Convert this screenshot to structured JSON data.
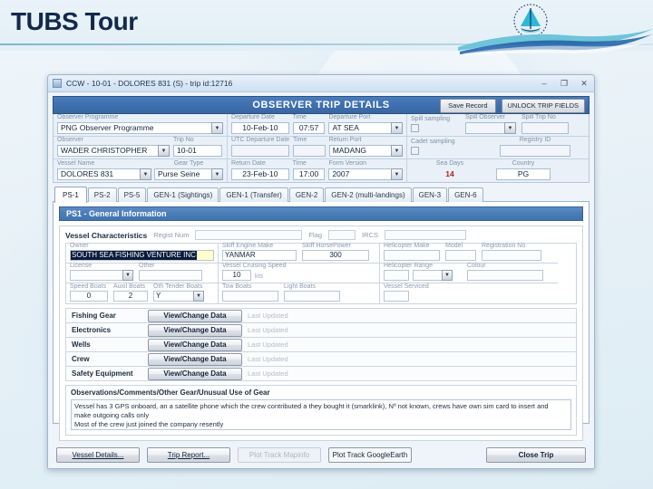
{
  "slide": {
    "title": "TUBS Tour",
    "logo_name": "sailboat-logo"
  },
  "window": {
    "titlebar_text": "CCW - 10-01 - DOLORES 831 (S) - trip id:12716",
    "minimize": "–",
    "maximize": "❐",
    "close": "✕"
  },
  "trip_header": {
    "title": "OBSERVER TRIP DETAILS",
    "save_label": "Save Record",
    "unlock_label": "UNLOCK TRIP FIELDS"
  },
  "trip_fields": {
    "observer_programme": {
      "label": "Observer Programme",
      "value": "PNG Observer Programme"
    },
    "observer": {
      "label": "Observer",
      "value": "WADER CHRISTOPHER"
    },
    "trip_no": {
      "label": "Trip No",
      "value": "10-01"
    },
    "vessel_name": {
      "label": "Vessel Name",
      "value": "DOLORES 831"
    },
    "gear_type": {
      "label": "Gear Type",
      "value": "Purse Seine"
    },
    "departure_date": {
      "label": "Departure Date",
      "value": "10-Feb-10"
    },
    "departure_time": {
      "label": "Time",
      "value": "07:57"
    },
    "departure_port": {
      "label": "Departure Port",
      "value": "AT SEA"
    },
    "utc_departure_date": {
      "label": "UTC Departure Date",
      "value": ""
    },
    "utc_departure_time": {
      "label": "Time",
      "value": ""
    },
    "return_port": {
      "label": "Return Port",
      "value": "MADANG"
    },
    "return_date": {
      "label": "Return Date",
      "value": "23-Feb-10"
    },
    "return_time": {
      "label": "Time",
      "value": "17:00"
    },
    "form_version": {
      "label": "Form Version",
      "value": "2007"
    },
    "spill_sampling": {
      "label": "Spill sampling",
      "checked": false
    },
    "spill_observer": {
      "label": "Spill Observer",
      "value": ""
    },
    "spill_trip_no": {
      "label": "Spill Trip No",
      "value": ""
    },
    "cadet_sampling": {
      "label": "Cadet sampling",
      "checked": false
    },
    "registry_id": {
      "label": "Registry ID",
      "value": ""
    },
    "sea_days": {
      "label": "Sea Days",
      "value": "14"
    },
    "country": {
      "label": "Country",
      "value": "PG"
    }
  },
  "tabs": [
    {
      "label": "PS-1",
      "active": true
    },
    {
      "label": "PS-2",
      "active": false
    },
    {
      "label": "PS-5",
      "active": false
    },
    {
      "label": "GEN-1 (Sightings)",
      "active": false
    },
    {
      "label": "GEN-1 (Transfer)",
      "active": false
    },
    {
      "label": "GEN-2",
      "active": false
    },
    {
      "label": "GEN-2 (multi-landings)",
      "active": false
    },
    {
      "label": "GEN-3",
      "active": false
    },
    {
      "label": "GEN-6",
      "active": false
    }
  ],
  "section": {
    "title": "PS1 - General Information"
  },
  "vessel_characteristics": {
    "title": "Vessel Characteristics",
    "regist_num": {
      "label": "Regist Num",
      "value": ""
    },
    "flag": {
      "label": "Flag",
      "value": ""
    },
    "ircs": {
      "label": "IRCS",
      "value": ""
    },
    "owner": {
      "label": "Owner",
      "value": "SOUTH SEA FISHING VENTURE INC"
    },
    "license": {
      "label": "License",
      "value": ""
    },
    "other": {
      "label": "Other",
      "value": ""
    },
    "speed_boats": {
      "label": "Speed Boats",
      "value": "0"
    },
    "auxil_boats": {
      "label": "Auxil Boats",
      "value": "2"
    },
    "oth_tender_boats": {
      "label": "Oth Tender Boats",
      "value": "Y"
    },
    "skiff_engine_make": {
      "label": "Skiff Engine Make",
      "value": "YANMAR"
    },
    "skiff_horsepower": {
      "label": "Skiff HorsePower",
      "value": "300"
    },
    "vessel_cruising_speed": {
      "label": "Vessel Cruising Speed",
      "value": "10",
      "unit": "kts"
    },
    "tow_boats": {
      "label": "Tow Boats",
      "value": ""
    },
    "light_boats": {
      "label": "Light Boats",
      "value": ""
    },
    "helicopter_make": {
      "label": "Helicopter Make",
      "value": ""
    },
    "model": {
      "label": "Model",
      "value": ""
    },
    "registration_no": {
      "label": "Registration No",
      "value": ""
    },
    "helicopter_range": {
      "label": "Helicopter Range",
      "value": ""
    },
    "colour": {
      "label": "Colour",
      "value": ""
    },
    "vessel_serviced": {
      "label": "Vessel Serviced",
      "value": ""
    }
  },
  "data_rows": [
    {
      "name": "Fishing Gear",
      "button": "View/Change Data",
      "last_updated": "Last Updated"
    },
    {
      "name": "Electronics",
      "button": "View/Change Data",
      "last_updated": "Last Updated"
    },
    {
      "name": "Wells",
      "button": "View/Change Data",
      "last_updated": "Last Updated"
    },
    {
      "name": "Crew",
      "button": "View/Change Data",
      "last_updated": "Last Updated"
    },
    {
      "name": "Safety Equipment",
      "button": "View/Change Data",
      "last_updated": "Last Updated"
    }
  ],
  "observations": {
    "title": "Observations/Comments/Other Gear/Unusual Use of Gear",
    "line1": "Vessel has 3 GPS onboard, an a satellite phone which the crew contributed a they bought it (smarklink), Nº not known, crews have own sim card to insert and",
    "line2": "make outgoing calls only",
    "line3": "Most of the crew just joined the company resently"
  },
  "bottom_bar": {
    "vessel_details": "Vessel Details...",
    "trip_report": "Trip Report...",
    "plot_track_mapinfo": "Plot Track Mapinfo",
    "plot_track_googleearth": "Plot Track GoogleEarth",
    "close_trip": "Close Trip"
  },
  "colors": {
    "accent_blue": "#4274ae",
    "header_dark": "#12294b",
    "selection": "#0a1a3c",
    "highlight_yellow": "#ffffcc",
    "sea_days_red": "#aa2222"
  }
}
